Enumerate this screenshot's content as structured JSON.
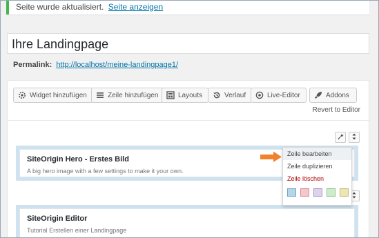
{
  "notice": {
    "text": "Seite wurde aktualisiert.",
    "link": "Seite anzeigen"
  },
  "post": {
    "title": "Ihre Landingpage",
    "permalink_label": "Permalink:",
    "permalink_url": "http://localhost/meine-landingpage1/"
  },
  "toolbar": {
    "widget": "Widget hinzufügen",
    "row": "Zeile hinzufügen",
    "layouts": "Layouts",
    "history": "Verlauf",
    "live_editor": "Live-Editor",
    "addons": "Addons",
    "revert": "Revert to Editor"
  },
  "rows": [
    {
      "title": "SiteOrigin Hero - Erstes Bild",
      "desc": "A big hero image with a few settings to make it your own."
    },
    {
      "title": "SiteOrigin Editor",
      "desc": "Tutorial Erstellen einer Landingpage"
    }
  ],
  "row_menu": {
    "edit": "Zeile bearbeiten",
    "duplicate": "Zeile duplizieren",
    "delete": "Zeile löschen",
    "swatches": [
      {
        "fill": "#b7d5e9",
        "border": "#6fa6c9"
      },
      {
        "fill": "#f3c7cc",
        "border": "#d88a94"
      },
      {
        "fill": "#ddd3ec",
        "border": "#a995c8"
      },
      {
        "fill": "#cdeccc",
        "border": "#8dc48c"
      },
      {
        "fill": "#ece6b7",
        "border": "#c6b96a"
      }
    ]
  },
  "colors": {
    "accent_link": "#0073aa",
    "notice_border": "#46b450",
    "row_bg": "#cfe2ef",
    "danger": "#aa0000",
    "arrow": "#f0822f"
  }
}
